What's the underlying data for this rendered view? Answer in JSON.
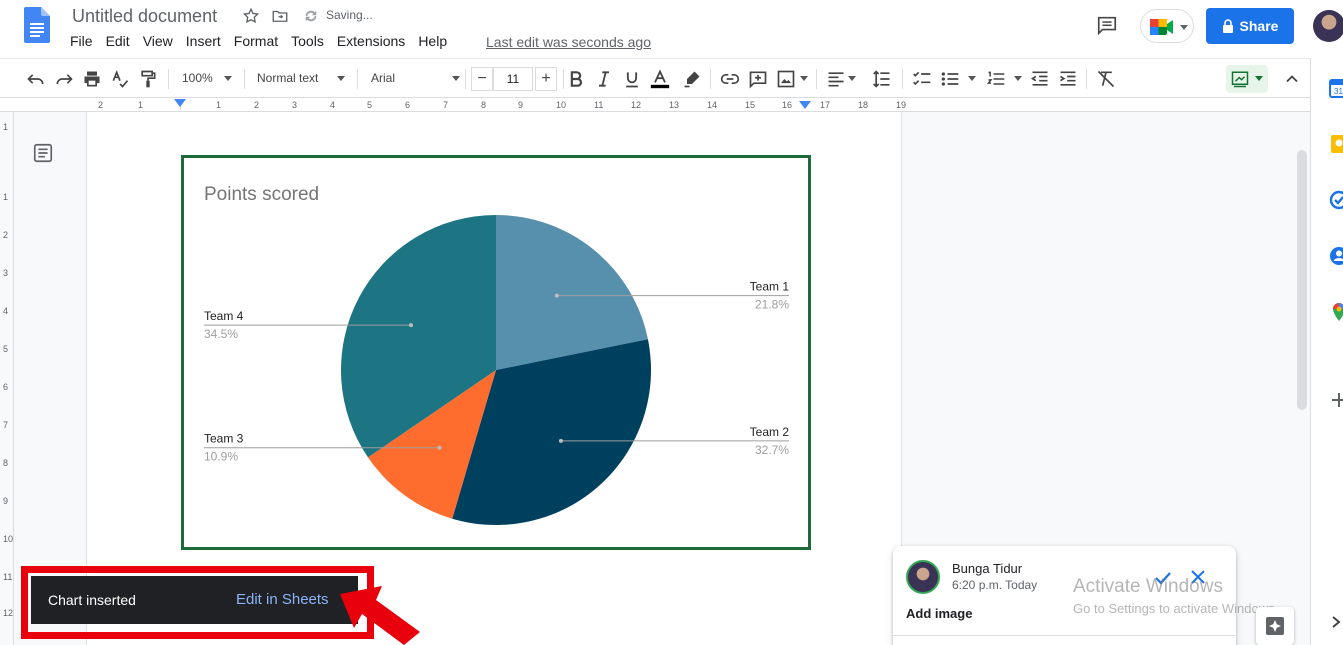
{
  "header": {
    "doc_title": "Untitled document",
    "saving_status": "Saving...",
    "last_edit": "Last edit was seconds ago",
    "share_label": "Share",
    "menu": [
      "File",
      "Edit",
      "View",
      "Insert",
      "Format",
      "Tools",
      "Extensions",
      "Help"
    ]
  },
  "toolbar": {
    "zoom": "100%",
    "style": "Normal text",
    "font": "Arial",
    "font_size": "11",
    "minus": "−",
    "plus": "+"
  },
  "ruler": {
    "h_numbers": [
      "2",
      "1",
      "1",
      "2",
      "3",
      "4",
      "5",
      "6",
      "7",
      "8",
      "9",
      "10",
      "11",
      "12",
      "13",
      "14",
      "15",
      "16",
      "17",
      "18",
      "19"
    ],
    "v_numbers": [
      "1",
      "1",
      "2",
      "3",
      "4",
      "5",
      "6",
      "7",
      "8",
      "9",
      "10",
      "11",
      "12"
    ]
  },
  "chart_data": {
    "type": "pie",
    "title": "Points scored",
    "slices": [
      {
        "label": "Team 1",
        "percent_label": "21.8%",
        "value": 21.8,
        "color": "#5790ad"
      },
      {
        "label": "Team 2",
        "percent_label": "32.7%",
        "value": 32.7,
        "color": "#00405f"
      },
      {
        "label": "Team 3",
        "percent_label": "10.9%",
        "value": 10.9,
        "color": "#ff6d2e"
      },
      {
        "label": "Team 4",
        "percent_label": "34.5%",
        "value": 34.5,
        "color": "#1d7482"
      }
    ],
    "legend": "labeled",
    "frame_color": "#1e6b3a"
  },
  "snackbar": {
    "message": "Chart inserted",
    "action": "Edit in Sheets"
  },
  "comment": {
    "author": "Bunga Tidur",
    "time": "6:20 p.m. Today",
    "body": "Add image"
  },
  "watermark": {
    "title": "Activate Windows",
    "subtitle": "Go to Settings to activate Windows."
  },
  "colors": {
    "share_blue": "#1a73e8",
    "highlight_red": "#e8000d",
    "snackbar_bg": "#202124",
    "snackbar_action": "#8ab4f8"
  }
}
